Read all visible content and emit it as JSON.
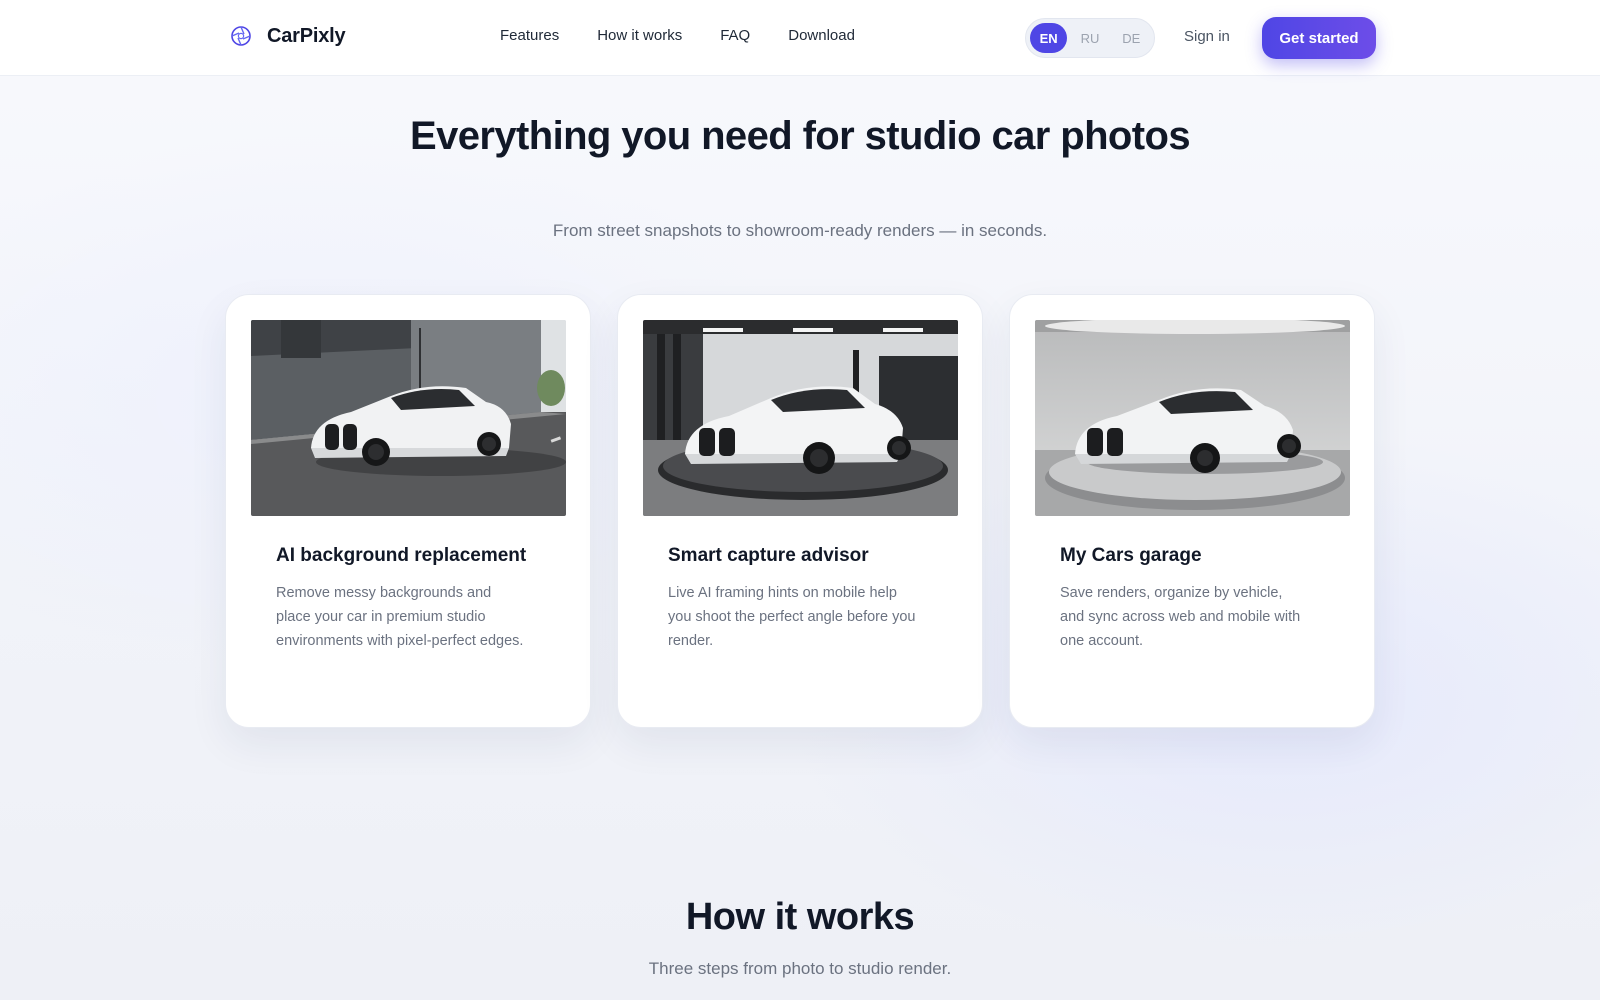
{
  "header": {
    "brand": "CarPixly",
    "brand_icon": "aperture-logo-icon",
    "nav": [
      {
        "label": "Features"
      },
      {
        "label": "How it works"
      },
      {
        "label": "FAQ"
      },
      {
        "label": "Download"
      }
    ],
    "languages": [
      {
        "code": "EN",
        "active": true
      },
      {
        "code": "RU",
        "active": false
      },
      {
        "code": "DE",
        "active": false
      }
    ],
    "sign_in": "Sign in",
    "cta": "Get started",
    "accent_color": "#4f46e5"
  },
  "hero": {
    "title": "Everything you need for studio car photos",
    "subtitle": "From street snapshots to showroom-ready renders — in seconds."
  },
  "features": [
    {
      "image": "white-coupe-street-photo",
      "title": "AI background replacement",
      "description": "Remove messy backgrounds and place your car in premium studio environments with pixel-perfect edges."
    },
    {
      "image": "white-coupe-garage-turntable-photo",
      "title": "Smart capture advisor",
      "description": "Live AI framing hints on mobile help you shoot the perfect angle before you render."
    },
    {
      "image": "white-coupe-studio-render-photo",
      "title": "My Cars garage",
      "description": "Save renders, organize by vehicle, and sync across web and mobile with one account."
    }
  ],
  "how_it_works": {
    "title": "How it works",
    "subtitle": "Three steps from photo to studio render."
  }
}
